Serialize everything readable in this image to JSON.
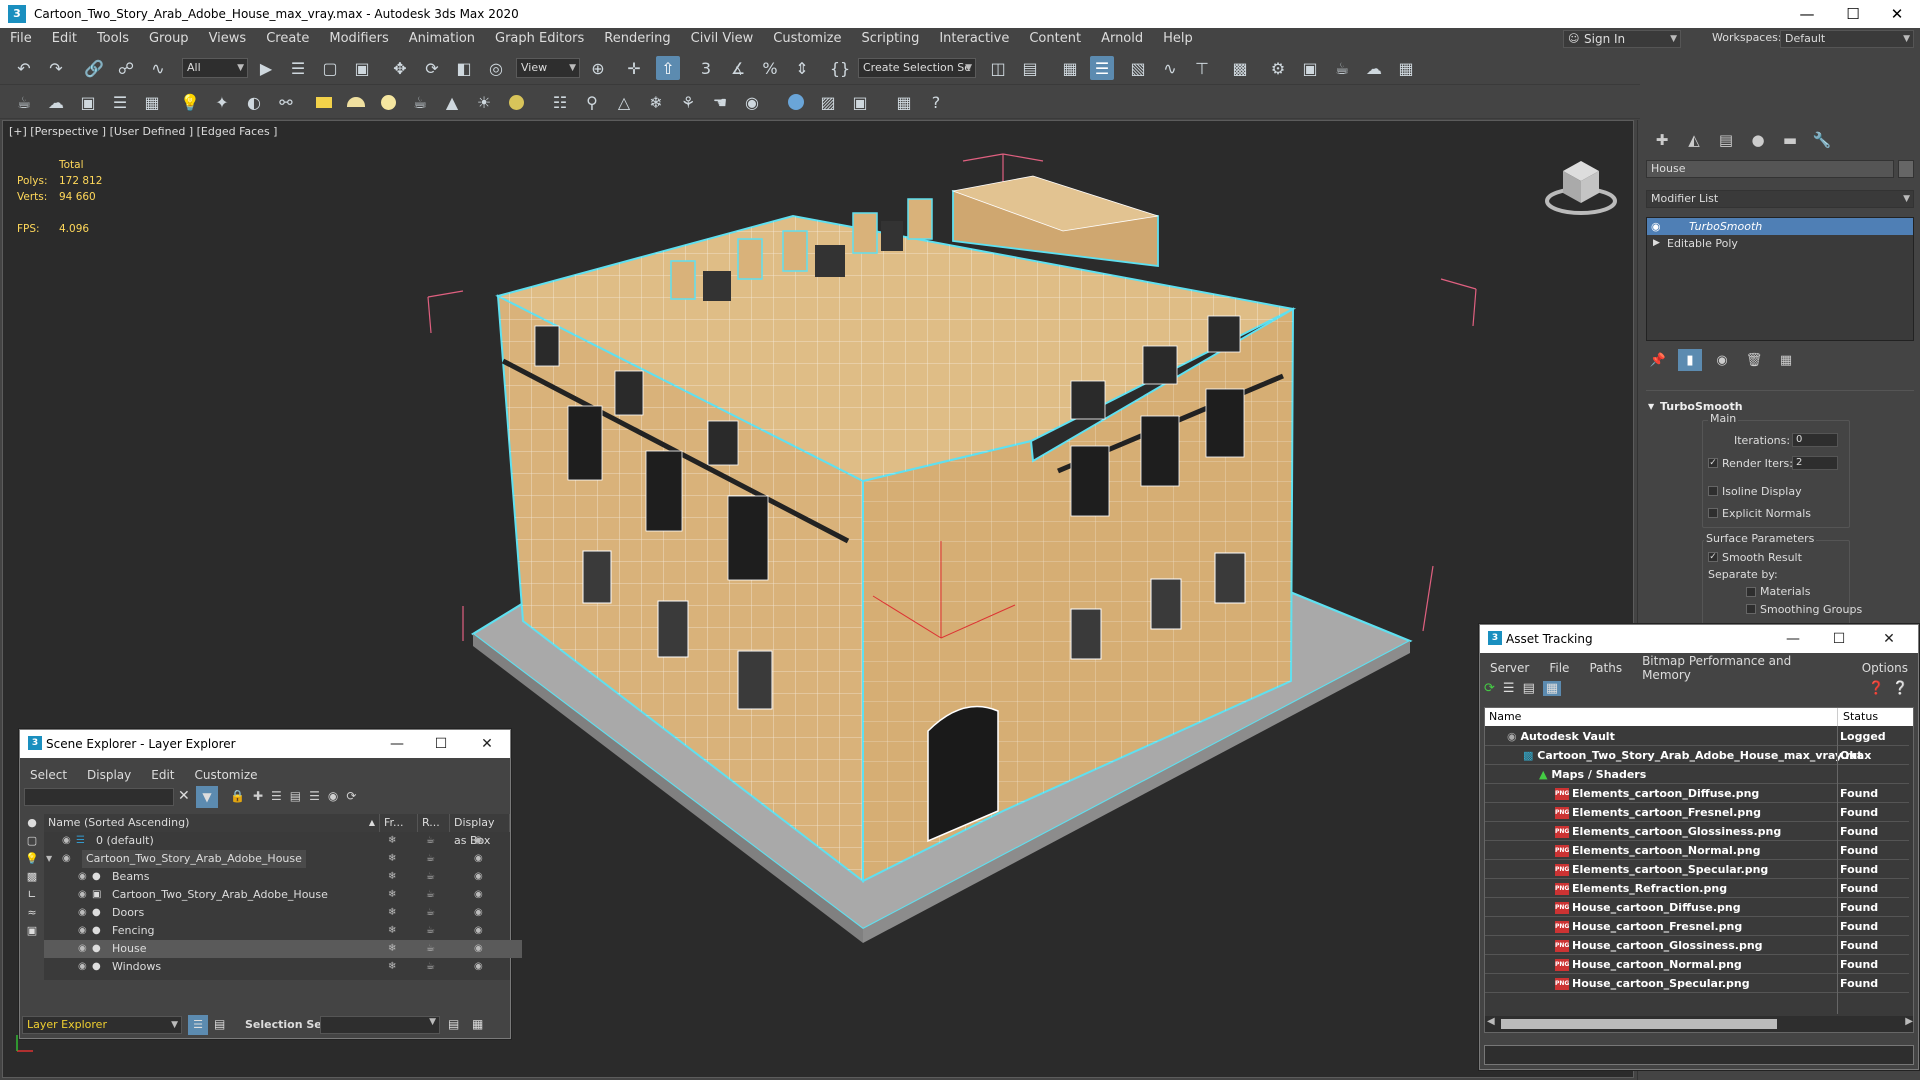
{
  "window": {
    "title": "Cartoon_Two_Story_Arab_Adobe_House_max_vray.max - Autodesk 3ds Max 2020",
    "logo": "3"
  },
  "menu": [
    "File",
    "Edit",
    "Tools",
    "Group",
    "Views",
    "Create",
    "Modifiers",
    "Animation",
    "Graph Editors",
    "Rendering",
    "Civil View",
    "Customize",
    "Scripting",
    "Interactive",
    "Content",
    "Arnold",
    "Help"
  ],
  "signin": {
    "label": "Sign In"
  },
  "workspaces": {
    "label": "Workspaces:",
    "value": "Default"
  },
  "toolbar": {
    "filter": "All",
    "view": "View",
    "create_selection": "Create Selection Se"
  },
  "viewport": {
    "label": "[+] [Perspective ] [User Defined ] [Edged Faces ]",
    "stats": {
      "header": "Total",
      "polys_label": "Polys:",
      "polys": "172 812",
      "verts_label": "Verts:",
      "verts": "94 660",
      "fps_label": "FPS:",
      "fps": "4.096"
    }
  },
  "command_panel": {
    "object_name": "House",
    "modifier_list": "Modifier List",
    "stack": [
      "TurboSmooth",
      "Editable Poly"
    ],
    "rollout": {
      "title": "TurboSmooth",
      "main": "Main",
      "iterations_label": "Iterations:",
      "iterations": "0",
      "render_iters_label": "Render Iters:",
      "render_iters": "2",
      "isoline": "Isoline Display",
      "explicit": "Explicit Normals",
      "surface": "Surface Parameters",
      "smooth": "Smooth Result",
      "separate": "Separate by:",
      "materials": "Materials",
      "smoothing": "Smoothing Groups"
    }
  },
  "scene_explorer": {
    "title": "Scene Explorer - Layer Explorer",
    "menu": [
      "Select",
      "Display",
      "Edit",
      "Customize"
    ],
    "columns": [
      "Name (Sorted Ascending)",
      "Fr...",
      "R...",
      "Display as Box"
    ],
    "rows": [
      {
        "name": "0 (default)"
      },
      {
        "name": "Cartoon_Two_Story_Arab_Adobe_House"
      },
      {
        "name": "Beams"
      },
      {
        "name": "Cartoon_Two_Story_Arab_Adobe_House"
      },
      {
        "name": "Doors"
      },
      {
        "name": "Fencing"
      },
      {
        "name": "House"
      },
      {
        "name": "Windows"
      }
    ],
    "footer_explorer": "Layer Explorer",
    "selection_set": "Selection Set:"
  },
  "asset_tracking": {
    "title": "Asset Tracking",
    "menu": [
      "Server",
      "File",
      "Paths",
      "Bitmap Performance and Memory",
      "Options"
    ],
    "columns": [
      "Name",
      "Status"
    ],
    "rows": [
      {
        "name": "Autodesk Vault",
        "status": "Logged Out"
      },
      {
        "name": "Cartoon_Two_Story_Arab_Adobe_House_max_vray.max",
        "status": "Ok"
      },
      {
        "name": "Maps / Shaders",
        "status": ""
      },
      {
        "name": "Elements_cartoon_Diffuse.png",
        "status": "Found"
      },
      {
        "name": "Elements_cartoon_Fresnel.png",
        "status": "Found"
      },
      {
        "name": "Elements_cartoon_Glossiness.png",
        "status": "Found"
      },
      {
        "name": "Elements_cartoon_Normal.png",
        "status": "Found"
      },
      {
        "name": "Elements_cartoon_Specular.png",
        "status": "Found"
      },
      {
        "name": "Elements_Refraction.png",
        "status": "Found"
      },
      {
        "name": "House_cartoon_Diffuse.png",
        "status": "Found"
      },
      {
        "name": "House_cartoon_Fresnel.png",
        "status": "Found"
      },
      {
        "name": "House_cartoon_Glossiness.png",
        "status": "Found"
      },
      {
        "name": "House_cartoon_Normal.png",
        "status": "Found"
      },
      {
        "name": "House_cartoon_Specular.png",
        "status": "Found"
      }
    ]
  },
  "colors": {
    "selection": "#4f7fb5",
    "stats": "#ffd85a",
    "highlight_outline": "#5fe0f0",
    "adobe": "#d9b27a"
  }
}
